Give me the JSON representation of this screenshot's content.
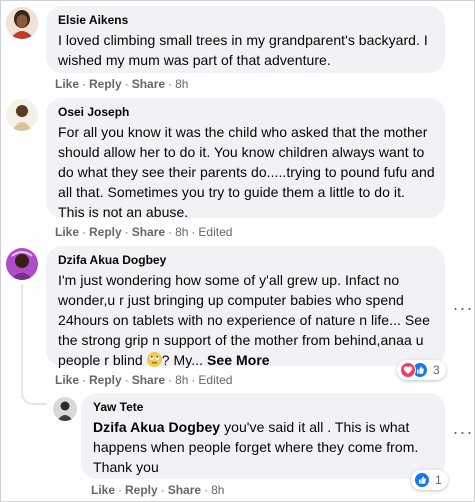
{
  "colors": {
    "bubble": "#f0f2f5",
    "meta": "#65676b",
    "like_blue": "#1877f2",
    "love_red": "#f33e58"
  },
  "comments": [
    {
      "author": "Elsie Aikens",
      "text": "I loved climbing small trees in my grandparent's backyard. I wished my mum was part of that adventure.",
      "actions": {
        "like": "Like",
        "reply": "Reply",
        "share": "Share",
        "time": "8h"
      },
      "avatar_icon": "profile-photo"
    },
    {
      "author": "Osei Joseph",
      "text": "For all you know it was the child who asked that the mother should allow her to do it. You know children always want to do what they see their parents do.....trying to pound fufu and all that. Sometimes you try to guide them a little to do it. This is not an abuse.",
      "actions": {
        "like": "Like",
        "reply": "Reply",
        "share": "Share",
        "time": "8h",
        "edited": "Edited"
      },
      "avatar_icon": "profile-photo"
    },
    {
      "author": "Dzifa Akua Dogbey",
      "text": "I'm just wondering how some of y'all grew up. Infact no wonder,u r just bringing up computer babies who spend 24hours on tablets with no experience of nature n life... See the strong grip n support of the mother from behind,anaa u people r blind",
      "text_tail": "? My...",
      "see_more": "See More",
      "emoji_icon": "face-with-rolling-eyes-emoji",
      "reaction_count": "3",
      "reaction_icons": [
        "love-reaction-icon",
        "like-reaction-icon"
      ],
      "actions": {
        "like": "Like",
        "reply": "Reply",
        "share": "Share",
        "time": "8h",
        "edited": "Edited"
      },
      "avatar_icon": "profile-photo"
    }
  ],
  "reply": {
    "author": "Yaw Tete",
    "mention": "Dzifa Akua Dogbey",
    "text": " you've said it all . This is what happens when people forget where they come from. Thank you",
    "reaction_count": "1",
    "reaction_icons": [
      "like-reaction-icon"
    ],
    "actions": {
      "like": "Like",
      "reply": "Reply",
      "share": "Share",
      "time": "8h"
    },
    "avatar_icon": "profile-photo"
  },
  "more_options_glyph": "···"
}
